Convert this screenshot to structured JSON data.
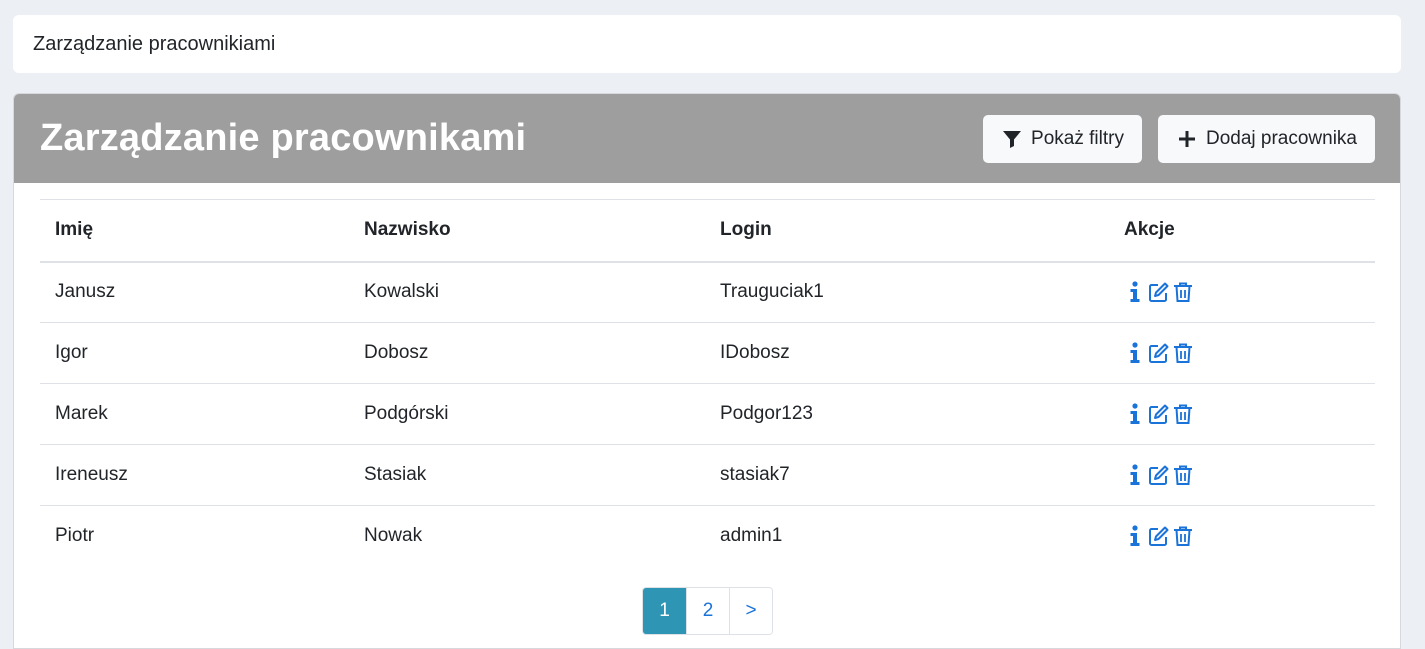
{
  "breadcrumb": {
    "text": "Zarządzanie pracownikiami"
  },
  "card": {
    "title": "Zarządzanie pracownikami",
    "show_filters_label": "Pokaż filtry",
    "add_employee_label": "Dodaj pracownika"
  },
  "table": {
    "headers": {
      "first_name": "Imię",
      "last_name": "Nazwisko",
      "login": "Login",
      "actions": "Akcje"
    },
    "rows": [
      {
        "first_name": "Janusz",
        "last_name": "Kowalski",
        "login": "Trauguciak1"
      },
      {
        "first_name": "Igor",
        "last_name": "Dobosz",
        "login": "IDobosz"
      },
      {
        "first_name": "Marek",
        "last_name": "Podgórski",
        "login": "Podgor123"
      },
      {
        "first_name": "Ireneusz",
        "last_name": "Stasiak",
        "login": "stasiak7"
      },
      {
        "first_name": "Piotr",
        "last_name": "Nowak",
        "login": "admin1"
      }
    ],
    "row_action_icons": [
      "info-icon",
      "edit-icon",
      "trash-icon"
    ]
  },
  "pagination": {
    "pages": [
      "1",
      "2"
    ],
    "next": ">",
    "active": "1"
  },
  "colors": {
    "header_bg": "#9e9e9e",
    "accent": "#1a73d9",
    "active_page": "#2e96b4",
    "page_bg": "#eceff4"
  }
}
